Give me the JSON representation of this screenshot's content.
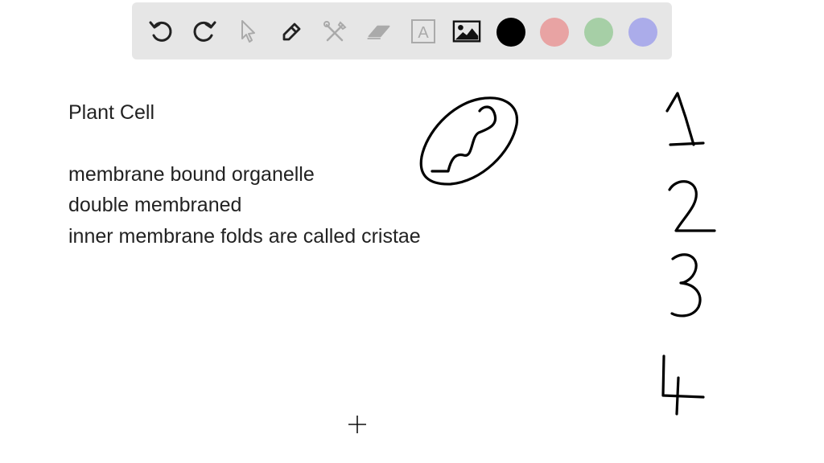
{
  "toolbar": {
    "tools": [
      {
        "name": "undo",
        "icon": "undo-icon",
        "enabled": true
      },
      {
        "name": "redo",
        "icon": "redo-icon",
        "enabled": true
      },
      {
        "name": "select",
        "icon": "pointer-icon",
        "enabled": false
      },
      {
        "name": "pen",
        "icon": "pen-icon",
        "enabled": true
      },
      {
        "name": "tools",
        "icon": "tools-icon",
        "enabled": false
      },
      {
        "name": "eraser",
        "icon": "eraser-icon",
        "enabled": false
      },
      {
        "name": "text",
        "icon": "text-icon",
        "enabled": false
      },
      {
        "name": "image",
        "icon": "image-icon",
        "enabled": true
      }
    ],
    "text_tool_letter": "A",
    "colors": [
      "#000000",
      "#e8a3a3",
      "#a6cfa6",
      "#abacea"
    ]
  },
  "whiteboard": {
    "lines": [
      "Plant Cell",
      "",
      "membrane bound organelle",
      "double membraned",
      "inner membrane folds are called cristae"
    ],
    "handwritten_numbers": [
      "1",
      "2",
      "3",
      "4"
    ]
  }
}
